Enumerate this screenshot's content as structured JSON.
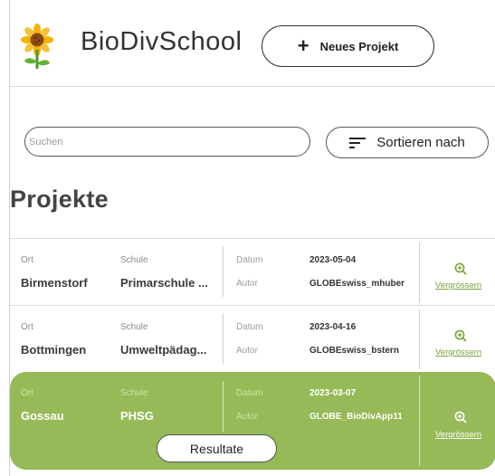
{
  "header": {
    "logo_icon": "sunflower-icon",
    "app_title": "BioDivSchool",
    "new_project_label": "Neues Projekt"
  },
  "search": {
    "placeholder": "Suchen",
    "value": "",
    "sort_label": "Sortieren nach",
    "sort_icon": "sort-lines-icon"
  },
  "page_title": "Projekte",
  "columns": {
    "ort": "Ort",
    "schule": "Schule",
    "datum": "Datum",
    "autor": "Autor"
  },
  "projects": [
    {
      "ort": "Birmenstorf",
      "schule": "Primarschule ...",
      "datum": "2023-05-04",
      "autor": "GLOBEswiss_mhuber",
      "zoom_label": "Vergrössern",
      "selected": false
    },
    {
      "ort": "Bottmingen",
      "schule": "Umweltpädag...",
      "datum": "2023-04-16",
      "autor": "GLOBEswiss_bstern",
      "zoom_label": "Vergrössern",
      "selected": false
    },
    {
      "ort": "Gossau",
      "schule": "PHSG",
      "datum": "2023-03-07",
      "autor": "GLOBE_BioDivApp11",
      "zoom_label": "Vergrössern",
      "selected": true,
      "results_label": "Resultate"
    }
  ],
  "colors": {
    "accent_green": "#95ba57",
    "link_green": "#7aa23c"
  }
}
